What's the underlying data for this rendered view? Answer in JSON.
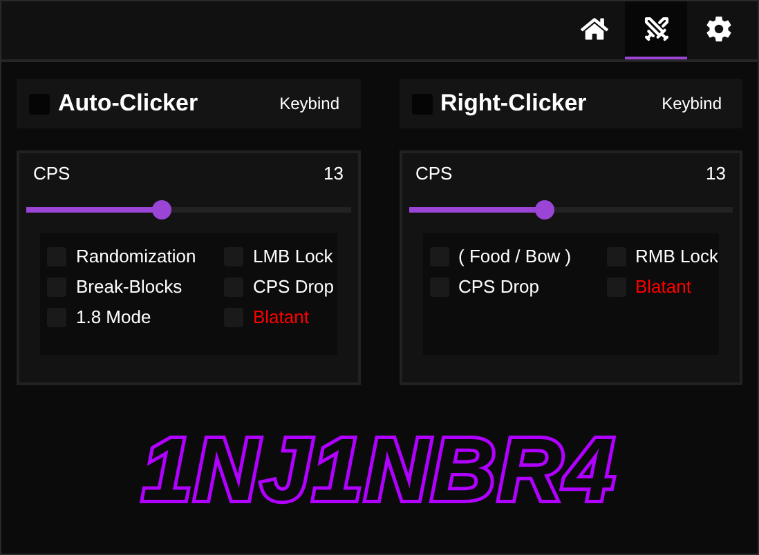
{
  "nav_tabs": [
    {
      "selected": false
    },
    {
      "selected": true
    },
    {
      "selected": false
    }
  ],
  "modules": [
    {
      "title": "Auto-Clicker",
      "enabled": false,
      "keybind": "Keybind",
      "slider_label": "CPS",
      "slider_value": "13",
      "level": 0.42,
      "options": [
        {
          "label": "Randomization",
          "checked": false,
          "kind": "normal"
        },
        {
          "label": "LMB Lock",
          "checked": false,
          "kind": "normal"
        },
        {
          "label": "Break-Blocks",
          "checked": false,
          "kind": "normal"
        },
        {
          "label": "CPS Drop",
          "checked": false,
          "kind": "normal"
        },
        {
          "label": "1.8 Mode",
          "checked": false,
          "kind": "normal"
        },
        {
          "label": "Blatant",
          "checked": false,
          "kind": "danger"
        }
      ]
    },
    {
      "title": "Right-Clicker",
      "enabled": false,
      "keybind": "Keybind",
      "slider_label": "CPS",
      "slider_value": "13",
      "level": 0.42,
      "options": [
        {
          "label": "( Food / Bow )",
          "checked": false,
          "kind": "normal"
        },
        {
          "label": "RMB Lock",
          "checked": false,
          "kind": "normal"
        },
        {
          "label": "CPS Drop",
          "checked": false,
          "kind": "normal"
        },
        {
          "label": "Blatant",
          "checked": false,
          "kind": "danger"
        }
      ]
    }
  ],
  "logo": "1NJ1NBR4"
}
